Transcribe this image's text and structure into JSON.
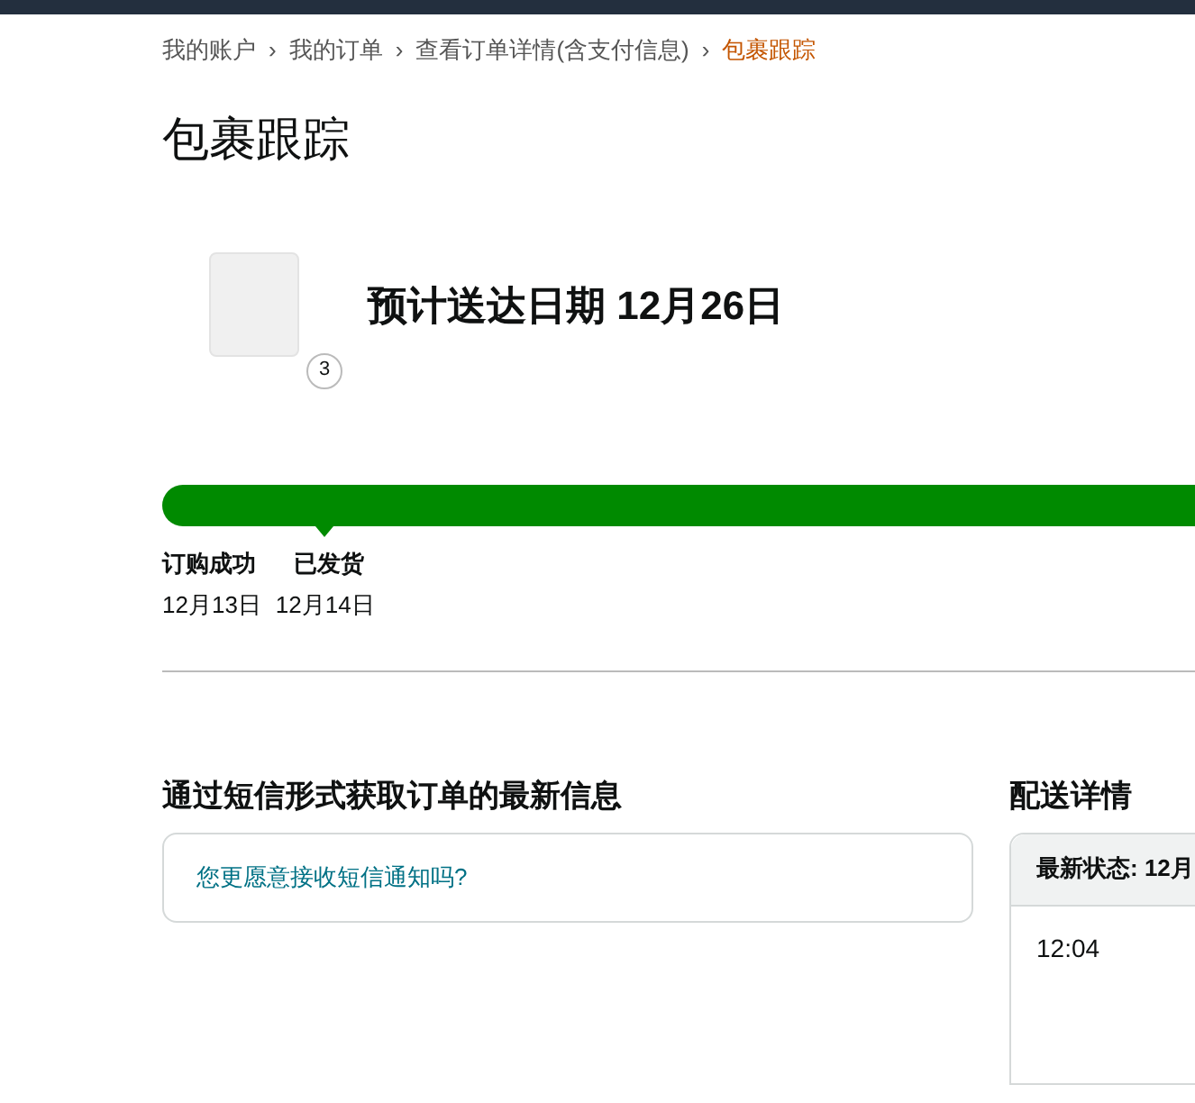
{
  "breadcrumb": [
    {
      "label": "我的账户",
      "current": false
    },
    {
      "label": "我的订单",
      "current": false
    },
    {
      "label": "查看订单详情(含支付信息)",
      "current": false
    },
    {
      "label": "包裹跟踪",
      "current": true
    }
  ],
  "breadcrumb_separator": "›",
  "title": "包裹跟踪",
  "shipment": {
    "item_count": "3",
    "delivery_estimate": "预计送达日期 12月26日"
  },
  "progress": {
    "level": 1,
    "milestones": [
      {
        "label": "订购成功",
        "date": "12月13日",
        "selected": false
      },
      {
        "label": "已发货",
        "date": "12月14日",
        "selected": true
      }
    ]
  },
  "sms": {
    "heading": "通过短信形式获取订单的最新信息",
    "link": "您更愿意接收短信通知吗?"
  },
  "delivery_details": {
    "heading": "配送详情",
    "status": "最新状态: 12月",
    "time": "12:04"
  }
}
